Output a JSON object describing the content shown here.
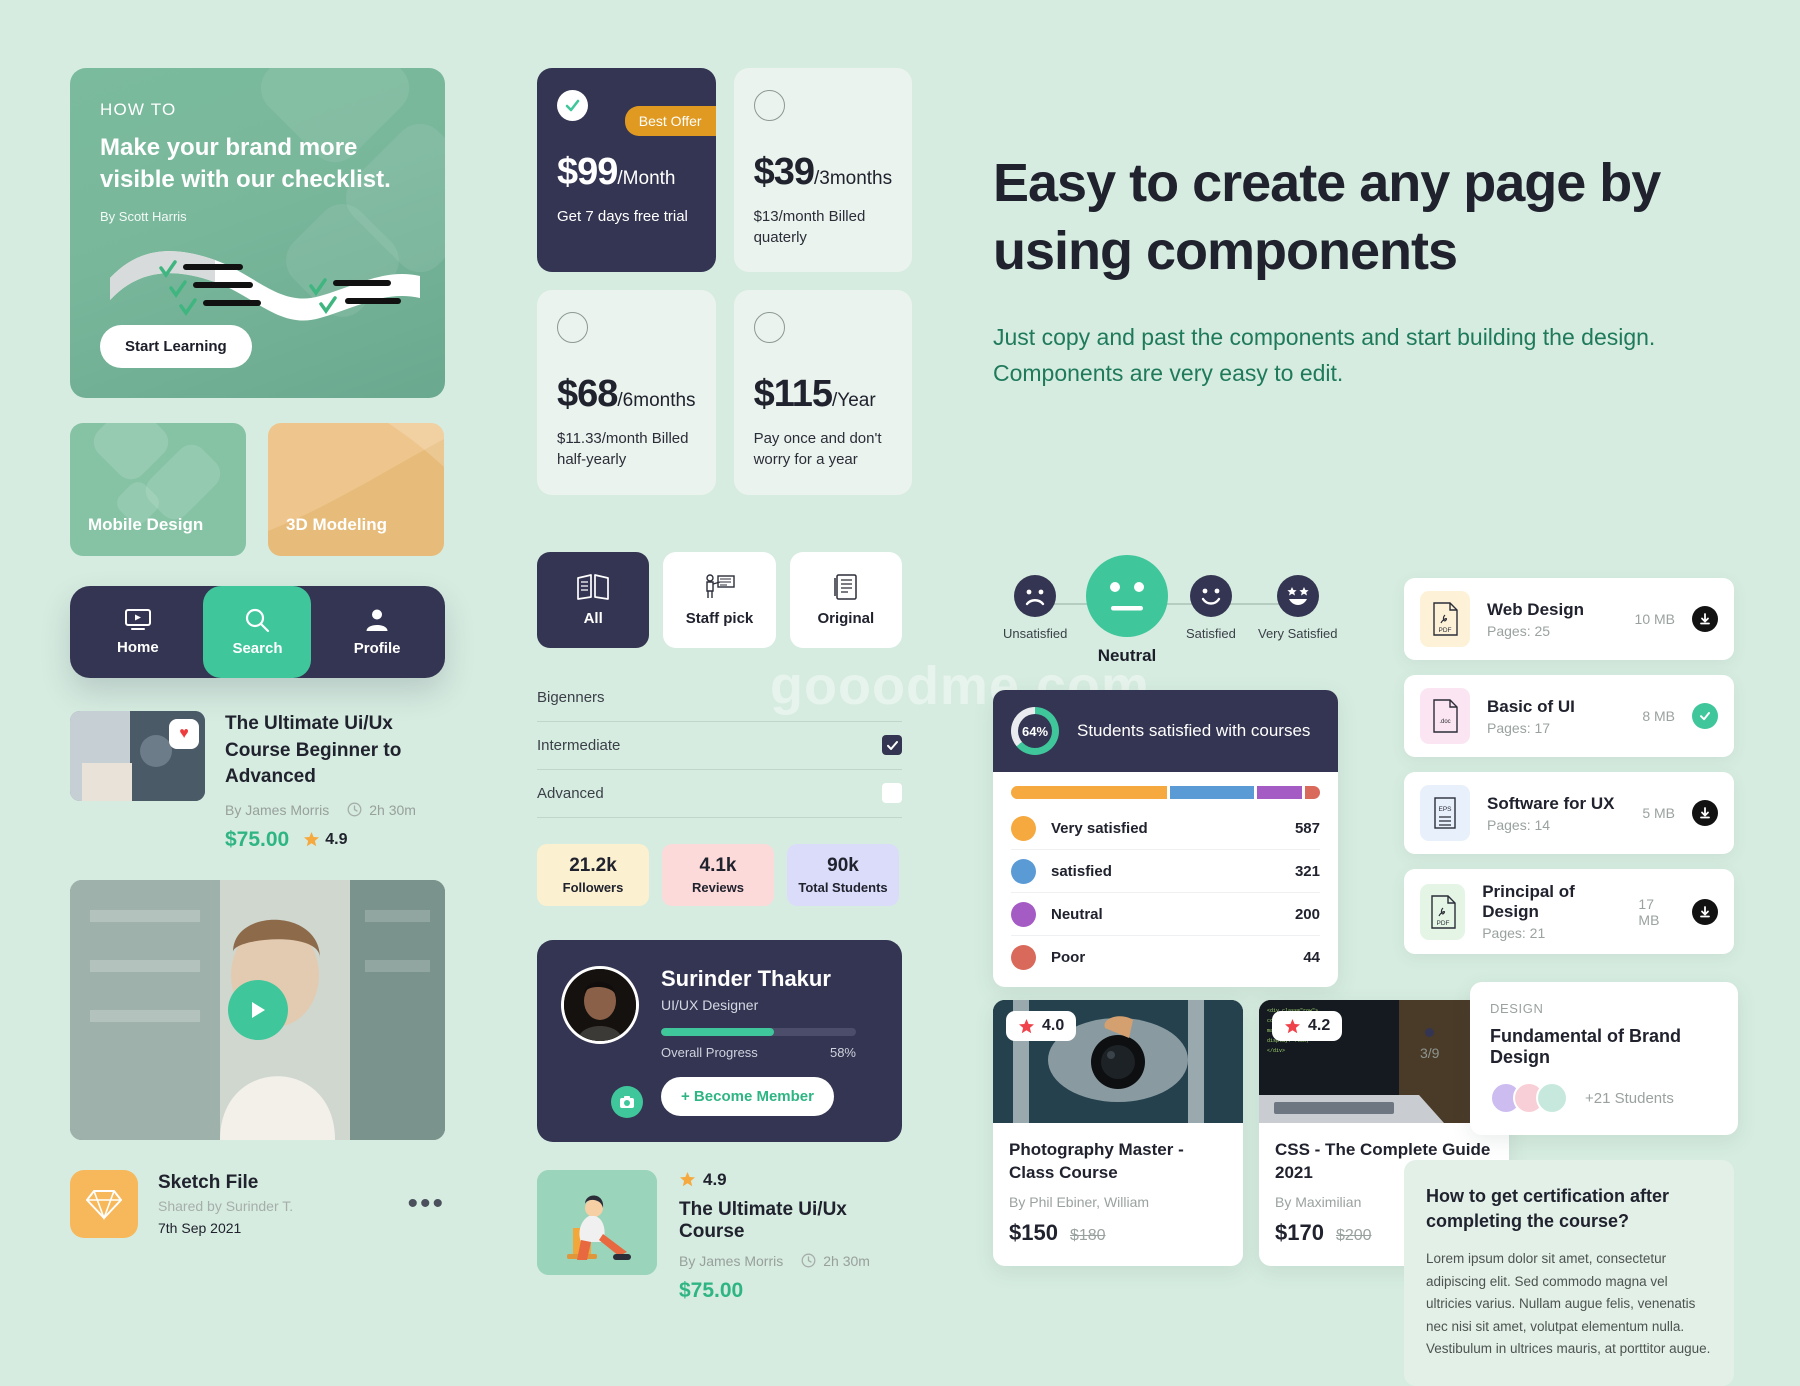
{
  "watermark": "gooodme.com",
  "hero": {
    "kicker": "HOW TO",
    "title": "Make your brand more visible with our checklist.",
    "byline": "By Scott Harris",
    "cta": "Start Learning"
  },
  "tiles": [
    {
      "label": "Mobile Design",
      "color": "#86c3a5"
    },
    {
      "label": "3D Modeling",
      "color": "#eec68d"
    }
  ],
  "navbar": {
    "items": [
      {
        "label": "Home",
        "icon": "video-icon",
        "active": false
      },
      {
        "label": "Search",
        "icon": "search-icon",
        "active": true
      },
      {
        "label": "Profile",
        "icon": "person-icon",
        "active": false
      }
    ],
    "active_color": "#3fc69b"
  },
  "course_row": {
    "title": "The Ultimate Ui/Ux Course Beginner to Advanced",
    "author": "By James Morris",
    "duration": "2h 30m",
    "price": "$75.00",
    "rating": "4.9"
  },
  "sketch_file": {
    "name": "Sketch File",
    "shared": "Shared by Surinder T.",
    "date": "7th Sep 2021",
    "menu": "•••"
  },
  "pricing": {
    "best_offer_badge": "Best Offer",
    "plans": [
      {
        "amount": "$99",
        "unit": "/Month",
        "note": "Get 7 days free trial",
        "selected": true
      },
      {
        "amount": "$39",
        "unit": "/3months",
        "note": "$13/month Billed quaterly",
        "selected": false
      },
      {
        "amount": "$68",
        "unit": "/6months",
        "note": "$11.33/month Billed half-yearly",
        "selected": false
      },
      {
        "amount": "$115",
        "unit": "/Year",
        "note": "Pay once and don't worry for a year",
        "selected": false
      }
    ]
  },
  "segments": [
    {
      "label": "All",
      "icon": "book-icon",
      "active": true
    },
    {
      "label": "Staff pick",
      "icon": "presenter-icon",
      "active": false
    },
    {
      "label": "Original",
      "icon": "notebook-icon",
      "active": false
    }
  ],
  "filters": [
    {
      "label": "Bigenners",
      "checked": null
    },
    {
      "label": "Intermediate",
      "checked": true
    },
    {
      "label": "Advanced",
      "checked": false
    }
  ],
  "stats": [
    {
      "value": "21.2k",
      "label": "Followers",
      "color": "#fbf0cf"
    },
    {
      "value": "4.1k",
      "label": "Reviews",
      "color": "#fcdada"
    },
    {
      "value": "90k",
      "label": "Total Students",
      "color": "#dbdcfa"
    }
  ],
  "profile": {
    "name": "Surinder Thakur",
    "role": "UI/UX Designer",
    "progress_label": "Overall Progress",
    "progress_value": "58%",
    "progress_pct": 58,
    "cta": "+ Become Member"
  },
  "mini_course": {
    "rating": "4.9",
    "title": "The Ultimate Ui/Ux Course",
    "author": "By James Morris",
    "duration": "2h 30m",
    "price": "$75.00"
  },
  "headline": {
    "title": "Easy to create any page by using components",
    "subtitle": "Just copy and past the components and start building the design. Components are very easy to edit.",
    "subtitle_color": "#1f7a5c"
  },
  "smileys": {
    "items": [
      {
        "label": "Unsatisfied",
        "face": "frown-icon",
        "big": false
      },
      {
        "label": "Neutral",
        "face": "neutral-icon",
        "big": true
      },
      {
        "label": "Satisfied",
        "face": "smile-icon",
        "big": false
      },
      {
        "label": "Very Satisfied",
        "face": "star-eyes-icon",
        "big": false
      }
    ]
  },
  "satisfaction": {
    "percent": "64%",
    "percent_value": 64,
    "title": "Students satisfied with courses",
    "rows": [
      {
        "label": "Very satisfied",
        "value": "587",
        "color": "#f5a93f",
        "width": 52
      },
      {
        "label": "satisfied",
        "value": "321",
        "color": "#5b9bd5",
        "width": 28
      },
      {
        "label": "Neutral",
        "value": "200",
        "color": "#a55bc4",
        "width": 15
      },
      {
        "label": "Poor",
        "value": "44",
        "color": "#d9695a",
        "width": 5
      }
    ]
  },
  "bottom_cards": [
    {
      "rating": "4.0",
      "title": "Photography Master - Class Course",
      "author": "By Phil Ebiner, William",
      "price": "$150",
      "old_price": "$180"
    },
    {
      "rating": "4.2",
      "title": "CSS - The Complete Guide 2021",
      "author": "By Maximilian",
      "price": "$170",
      "old_price": "$200"
    }
  ],
  "documents": [
    {
      "name": "Web Design",
      "pages": "Pages: 25",
      "size": "10 MB",
      "type": "PDF",
      "action": "download-icon",
      "tint": "#fdf1d8",
      "stroke": "#2b2d38"
    },
    {
      "name": "Basic of UI",
      "pages": "Pages: 17",
      "size": "8 MB",
      "type": ".doc",
      "action": "check-icon",
      "tint": "#fbe5f2",
      "stroke": "#2b2d38"
    },
    {
      "name": "Software for UX",
      "pages": "Pages: 14",
      "size": "5 MB",
      "type": "EPS",
      "action": "download-icon",
      "tint": "#e8f0fb",
      "stroke": "#2b2d38"
    },
    {
      "name": "Principal of Design",
      "pages": "Pages: 21",
      "size": "17 MB",
      "type": "PDF",
      "action": "download-icon",
      "tint": "#e4f5e6",
      "stroke": "#2b2d38"
    }
  ],
  "brand_card": {
    "kicker": "DESIGN",
    "title": "Fundamental of Brand Design",
    "students": "+21 Students",
    "pager": "3/9"
  },
  "faq": {
    "question": "How to get certification after completing the course?",
    "answer": "Lorem ipsum dolor sit amet, consectetur adipiscing elit. Sed commodo magna vel ultricies varius. Nullam augue felis, venenatis nec nisi sit amet, volutpat elementum nulla. Vestibulum in ultrices mauris, at porttitor augue."
  }
}
